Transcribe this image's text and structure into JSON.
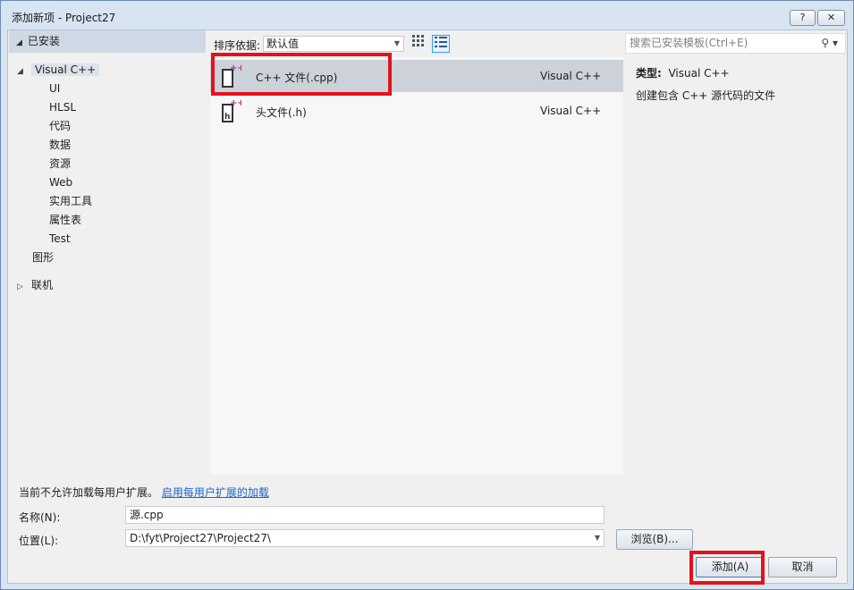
{
  "window": {
    "title": "添加新项 - Project27",
    "help_label": "?",
    "close_label": "✕"
  },
  "leftnav": {
    "header": "已安装",
    "items": [
      {
        "label": "Visual C++",
        "level": 0,
        "expanded": true,
        "selected": true
      },
      {
        "label": "UI",
        "level": 1
      },
      {
        "label": "HLSL",
        "level": 1
      },
      {
        "label": "代码",
        "level": 1
      },
      {
        "label": "数据",
        "level": 1
      },
      {
        "label": "资源",
        "level": 1
      },
      {
        "label": "Web",
        "level": 1
      },
      {
        "label": "实用工具",
        "level": 1
      },
      {
        "label": "属性表",
        "level": 1
      },
      {
        "label": "Test",
        "level": 1
      },
      {
        "label": "图形",
        "level": 0
      }
    ],
    "online": "联机"
  },
  "center": {
    "sort_label": "排序依据:",
    "sort_value": "默认值",
    "items": [
      {
        "name": "C++ 文件(.cpp)",
        "lang": "Visual C++",
        "selected": true,
        "icon": "cpp-file-icon"
      },
      {
        "name": "头文件(.h)",
        "lang": "Visual C++",
        "selected": false,
        "icon": "header-file-icon"
      }
    ]
  },
  "rightpane": {
    "search_placeholder": "搜索已安装模板(Ctrl+E)",
    "type_label": "类型:",
    "type_value": "Visual C++",
    "description": "创建包含 C++ 源代码的文件"
  },
  "bottom": {
    "notice_text": "当前不允许加载每用户扩展。",
    "notice_link": "启用每用户扩展的加载",
    "name_label": "名称(N):",
    "name_value": "源.cpp",
    "location_label": "位置(L):",
    "location_value": "D:\\fyt\\Project27\\Project27\\",
    "browse_label": "浏览(B)...",
    "add_label": "添加(A)",
    "cancel_label": "取消"
  },
  "colors": {
    "highlight": "#e2131d",
    "link": "#1c64c8",
    "selection": "#cdd1d9"
  }
}
